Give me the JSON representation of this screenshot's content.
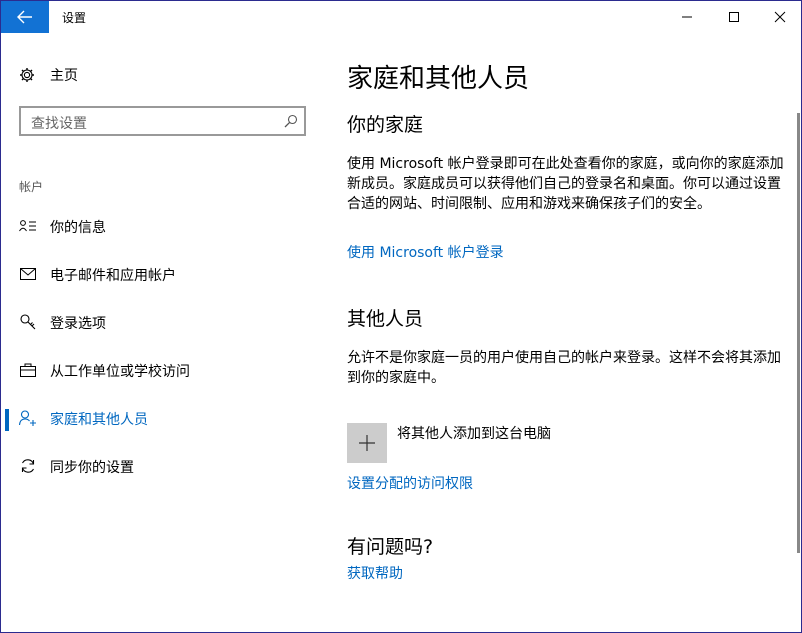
{
  "titlebar": {
    "title": "设置"
  },
  "sidebar": {
    "home_label": "主页",
    "search_placeholder": "查找设置",
    "section_label": "帐户",
    "items": [
      {
        "label": "你的信息",
        "icon": "person-list-icon"
      },
      {
        "label": "电子邮件和应用帐户",
        "icon": "mail-icon"
      },
      {
        "label": "登录选项",
        "icon": "key-icon"
      },
      {
        "label": "从工作单位或学校访问",
        "icon": "briefcase-icon"
      },
      {
        "label": "家庭和其他人员",
        "icon": "add-person-icon",
        "active": true
      },
      {
        "label": "同步你的设置",
        "icon": "sync-icon"
      }
    ]
  },
  "main": {
    "title": "家庭和其他人员",
    "family_heading": "你的家庭",
    "family_text": "使用 Microsoft 帐户登录即可在此处查看你的家庭，或向你的家庭添加新成员。家庭成员可以获得他们自己的登录名和桌面。你可以通过设置合适的网站、时间限制、应用和游戏来确保孩子们的安全。",
    "family_link": "使用 Microsoft 帐户登录",
    "others_heading": "其他人员",
    "others_text": "允许不是你家庭一员的用户使用自己的帐户来登录。这样不会将其添加到你的家庭中。",
    "add_label": "将其他人添加到这台电脑",
    "access_link": "设置分配的访问权限",
    "help_heading": "有问题吗?",
    "help_link": "获取帮助"
  },
  "colors": {
    "accent": "#0067c0",
    "back_button": "#1272d4"
  }
}
